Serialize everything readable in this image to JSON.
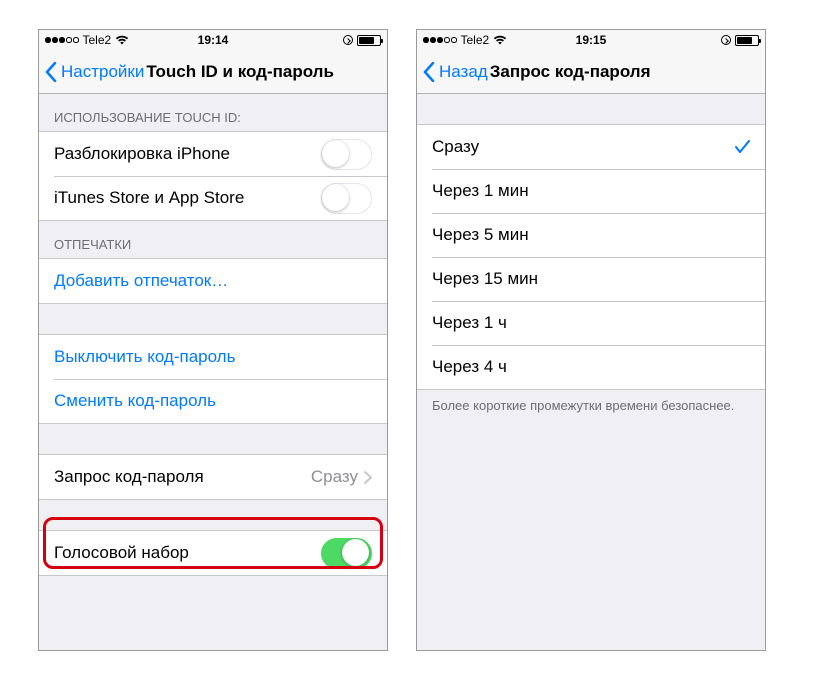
{
  "left": {
    "status": {
      "carrier": "Tele2",
      "time": "19:14"
    },
    "nav": {
      "back": "Настройки",
      "title": "Touch ID и код-пароль"
    },
    "section_touchid_header": "ИСПОЛЬЗОВАНИЕ TOUCH ID:",
    "unlock_label": "Разблокировка iPhone",
    "itunes_label": "iTunes Store и App Store",
    "section_fingerprints_header": "ОТПЕЧАТКИ",
    "add_fingerprint": "Добавить отпечаток…",
    "turn_off_passcode": "Выключить код-пароль",
    "change_passcode": "Сменить код-пароль",
    "require_passcode_label": "Запрос код-пароля",
    "require_passcode_value": "Сразу",
    "voice_dial": "Голосовой набор"
  },
  "right": {
    "status": {
      "carrier": "Tele2",
      "time": "19:15"
    },
    "nav": {
      "back": "Назад",
      "title": "Запрос код-пароля"
    },
    "options": [
      {
        "label": "Сразу",
        "selected": true
      },
      {
        "label": "Через 1 мин",
        "selected": false
      },
      {
        "label": "Через 5 мин",
        "selected": false
      },
      {
        "label": "Через 15 мин",
        "selected": false
      },
      {
        "label": "Через 1 ч",
        "selected": false
      },
      {
        "label": "Через 4 ч",
        "selected": false
      }
    ],
    "footer": "Более короткие промежутки времени безопаснее."
  }
}
